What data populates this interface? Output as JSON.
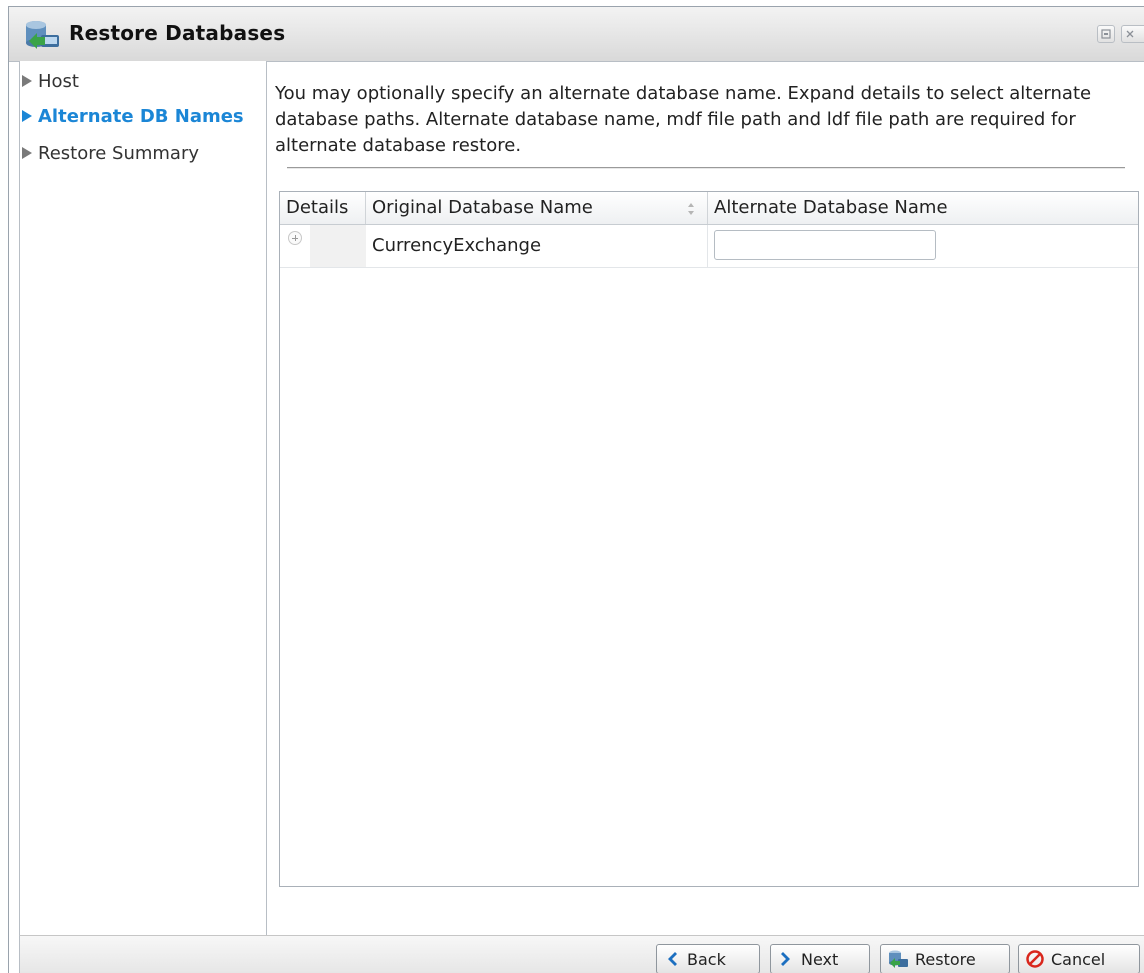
{
  "window": {
    "title": "Restore Databases",
    "icon": "database-restore-icon"
  },
  "sidebar": {
    "items": [
      {
        "label": "Host",
        "active": false
      },
      {
        "label": "Alternate DB Names",
        "active": true
      },
      {
        "label": "Restore Summary",
        "active": false
      }
    ]
  },
  "main": {
    "description": "You may optionally specify an alternate database name. Expand details to select alternate database paths. Alternate database name, mdf file path and ldf file path are required for alternate database restore.",
    "grid": {
      "columns": [
        "Details",
        "Original Database Name",
        "Alternate Database Name"
      ],
      "rows": [
        {
          "original_name": "CurrencyExchange",
          "alternate_name": ""
        }
      ]
    }
  },
  "footer": {
    "back_label": "Back",
    "next_label": "Next",
    "restore_label": "Restore",
    "cancel_label": "Cancel"
  },
  "colors": {
    "active_nav": "#1b86d6",
    "cancel_icon": "#d9261c"
  }
}
